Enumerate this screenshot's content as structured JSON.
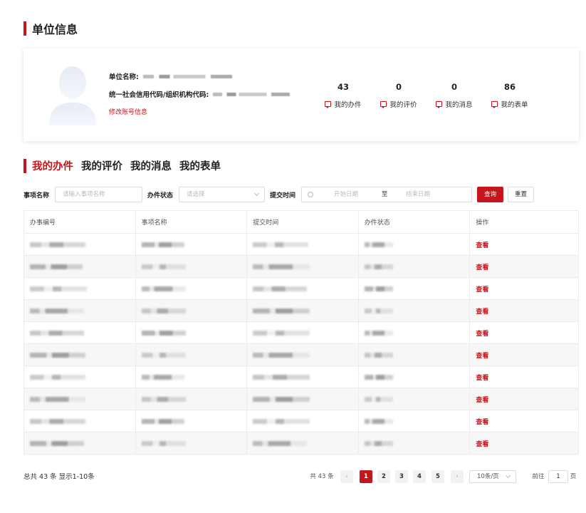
{
  "section1": {
    "title": "单位信息"
  },
  "profile": {
    "name_label": "单位名称:",
    "code_label": "统一社会信用代码/组织机构代码:",
    "edit_link": "修改账号信息"
  },
  "stats": [
    {
      "num": "43",
      "label": "我的办件"
    },
    {
      "num": "0",
      "label": "我的评价"
    },
    {
      "num": "0",
      "label": "我的消息"
    },
    {
      "num": "86",
      "label": "我的表单"
    }
  ],
  "tabs": [
    {
      "label": "我的办件",
      "active": true
    },
    {
      "label": "我的评价",
      "active": false
    },
    {
      "label": "我的消息",
      "active": false
    },
    {
      "label": "我的表单",
      "active": false
    }
  ],
  "filters": {
    "item_name_label": "事项名称",
    "item_name_placeholder": "请输入事项名称",
    "status_label": "办件状态",
    "status_placeholder": "请选择",
    "time_label": "提交时间",
    "start_placeholder": "开始日期",
    "to_label": "至",
    "end_placeholder": "结束日期",
    "query_button": "查询",
    "reset_button": "重置"
  },
  "table": {
    "headers": [
      "办事编号",
      "事项名称",
      "提交时间",
      "办件状态",
      "操作"
    ],
    "action_label": "查看",
    "row_count": 10
  },
  "footer": {
    "summary": "总共 43 条 显示1-10条",
    "total": "共 43 条",
    "pages": [
      "1",
      "2",
      "3",
      "4",
      "5"
    ],
    "current_page": "1",
    "prev": "‹",
    "next": "›",
    "page_size": "10条/页",
    "goto_label": "前往",
    "goto_value": "1",
    "page_unit": "页"
  },
  "colors": {
    "accent": "#c4161c"
  }
}
